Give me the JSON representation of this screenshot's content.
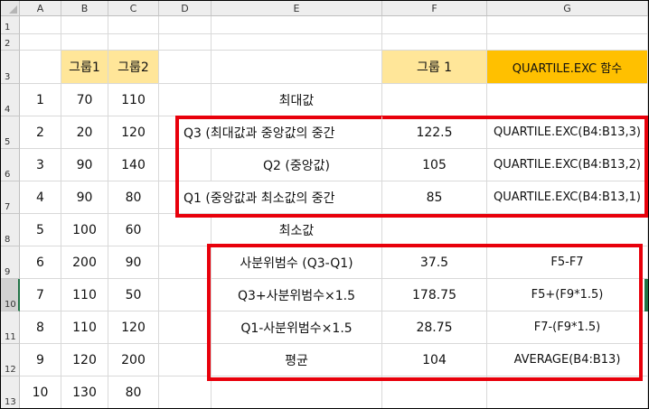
{
  "columns": [
    "A",
    "B",
    "C",
    "D",
    "E",
    "F",
    "G"
  ],
  "rows": [
    "1",
    "2",
    "3",
    "4",
    "5",
    "6",
    "7",
    "8",
    "9",
    "10",
    "11",
    "12",
    "13"
  ],
  "headers": {
    "group1": "그룹1",
    "group2": "그룹2",
    "f_title": "그룹 1",
    "g_title": "QUARTILE.EXC 함수"
  },
  "data_rows": [
    {
      "a": "1",
      "b": "70",
      "c": "110"
    },
    {
      "a": "2",
      "b": "20",
      "c": "120"
    },
    {
      "a": "3",
      "b": "90",
      "c": "140"
    },
    {
      "a": "4",
      "b": "90",
      "c": "80"
    },
    {
      "a": "5",
      "b": "100",
      "c": "60"
    },
    {
      "a": "6",
      "b": "200",
      "c": "90"
    },
    {
      "a": "7",
      "b": "110",
      "c": "50"
    },
    {
      "a": "8",
      "b": "110",
      "c": "120"
    },
    {
      "a": "9",
      "b": "120",
      "c": "200"
    },
    {
      "a": "10",
      "b": "130",
      "c": "80"
    }
  ],
  "stats": {
    "max_label": "최대값",
    "q3_label": "Q3 (최대값과 중앙값의 중간",
    "q3_value": "122.5",
    "q3_formula": "QUARTILE.EXC(B4:B13,3)",
    "q2_label": "Q2 (중앙값)",
    "q2_value": "105",
    "q2_formula": "QUARTILE.EXC(B4:B13,2)",
    "q1_label": "Q1 (중앙값과 최소값의 중간",
    "q1_value": "85",
    "q1_formula": "QUARTILE.EXC(B4:B13,1)",
    "min_label": "최소값",
    "iqr_label": "사분위범수 (Q3-Q1)",
    "iqr_value": "37.5",
    "iqr_formula": "F5-F7",
    "upper_label": "Q3+사분위범수×1.5",
    "upper_value": "178.75",
    "upper_formula": "F5+(F9*1.5)",
    "lower_label": "Q1-사분위범수×1.5",
    "lower_value": "28.75",
    "lower_formula": "F7-(F9*1.5)",
    "avg_label": "평균",
    "avg_value": "104",
    "avg_formula": "AVERAGE(B4:B13)"
  },
  "colors": {
    "header_fill": "#ffe699",
    "function_header_fill": "#ffc000",
    "highlight_box": "#e8000b",
    "selection": "#217346"
  }
}
